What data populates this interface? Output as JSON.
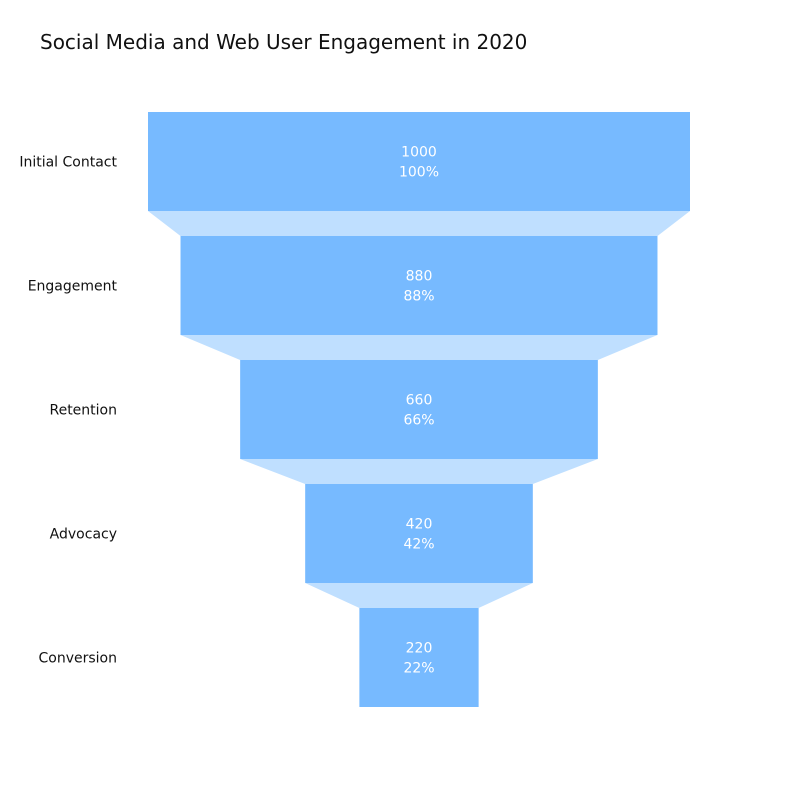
{
  "chart_data": {
    "type": "funnel",
    "title": "Social Media and Web User Engagement in 2020",
    "categories": [
      "Initial Contact",
      "Engagement",
      "Retention",
      "Advocacy",
      "Conversion"
    ],
    "values": [
      1000,
      880,
      660,
      420,
      220
    ],
    "percent_labels": [
      "100%",
      "88%",
      "66%",
      "42%",
      "22%"
    ],
    "bar_color": "#77baff",
    "connector_color": "#bfdfff",
    "text_color": "#ffffff"
  }
}
